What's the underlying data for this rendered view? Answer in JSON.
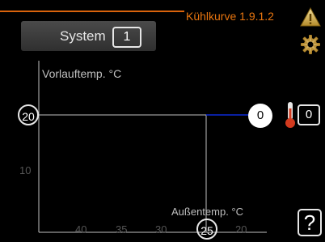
{
  "header": {
    "title": "Kühlkurve 1.9.1.2",
    "icons": [
      "warning-icon",
      "settings-icon"
    ]
  },
  "system": {
    "label": "System",
    "value": "1"
  },
  "chart": {
    "y_axis_label": "Vorlauftemp. °C",
    "x_axis_label": "Außentemp. °C",
    "y_ticks": [
      "20",
      "10"
    ],
    "x_ticks": [
      "40",
      "35",
      "30",
      "25",
      "20"
    ],
    "y_marker": "20",
    "x_marker": "25"
  },
  "side": {
    "output_value": "0",
    "offset_value": "0",
    "thermometer_icon": "thermometer-icon"
  },
  "help": {
    "label": "?"
  },
  "chart_data": {
    "type": "line",
    "xlabel": "Außentemp. °C",
    "ylabel": "Vorlauftemp. °C",
    "x_ticks": [
      40,
      35,
      30,
      25,
      20
    ],
    "y_ticks": [
      10,
      20
    ],
    "series": [
      {
        "x": [
          25,
          20
        ],
        "y": [
          20,
          20
        ]
      }
    ],
    "reference_lines": [
      {
        "y": 20,
        "x_from": 25
      },
      {
        "x": 25,
        "y_from": 20
      }
    ]
  }
}
